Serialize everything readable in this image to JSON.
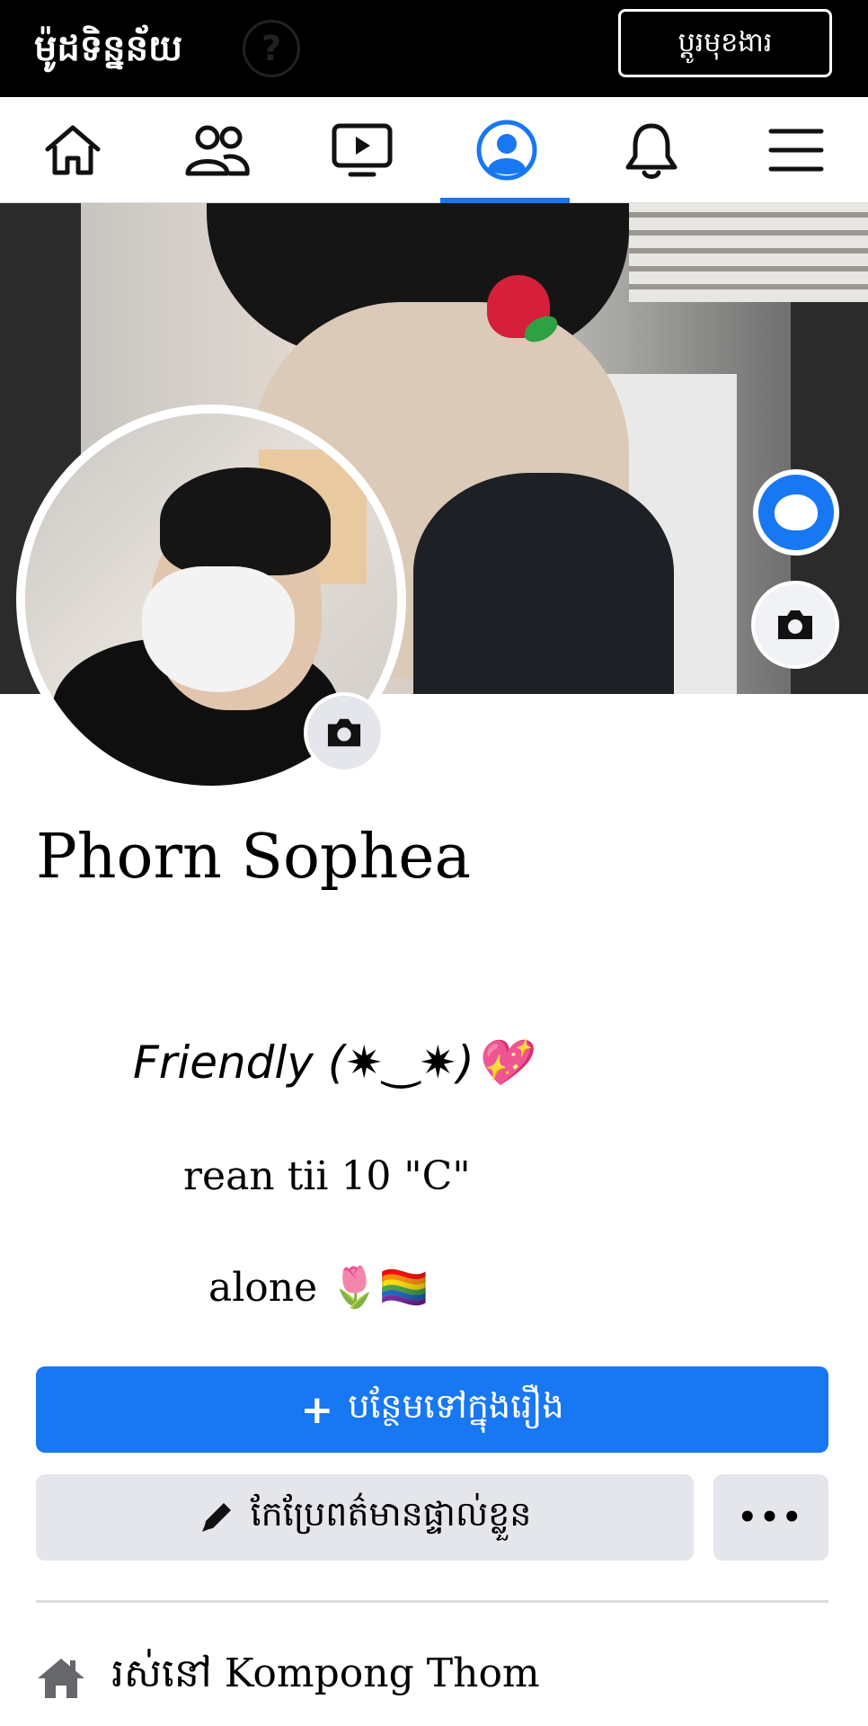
{
  "topbar": {
    "data_mode_label": "ម៉ូដទិន្នន័យ",
    "help_icon": "?",
    "switch_button_label": "ប្ដូរមុខងារ"
  },
  "nav": {
    "items": [
      {
        "name": "home-icon"
      },
      {
        "name": "friends-icon"
      },
      {
        "name": "watch-icon"
      },
      {
        "name": "profile-icon",
        "active": true
      },
      {
        "name": "notifications-icon"
      },
      {
        "name": "menu-icon"
      }
    ],
    "accent": "#1877f2"
  },
  "profile": {
    "name": "Phorn Sophea",
    "bio": {
      "line1": "Friendly (✷‿✷)💖",
      "line2": "rean tii 10 \"C\"",
      "line3": "alone 🌷🏳️‍🌈"
    }
  },
  "actions": {
    "add_story_icon": "+",
    "add_story_label": "បន្ថែមទៅក្នុងរឿង",
    "edit_profile_label": "កែប្រែពត៌មានផ្ទាល់ខ្លួន",
    "more_label": "•••"
  },
  "details": {
    "lives_in": "រស់នៅ Kompong Thom"
  },
  "colors": {
    "primary": "#1877f2",
    "secondary_button": "#e4e6eb",
    "topbar": "#000000"
  }
}
